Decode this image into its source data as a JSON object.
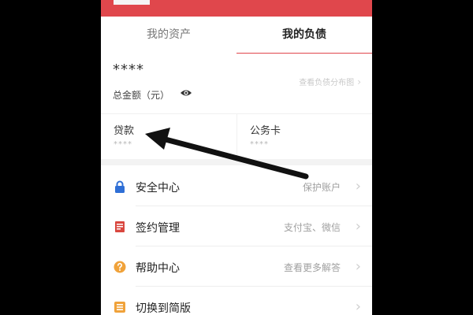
{
  "tabs": [
    {
      "label": "我的资产",
      "active": false
    },
    {
      "label": "我的负债",
      "active": true
    }
  ],
  "summary": {
    "masked_total": "****",
    "total_label": "总金额（元）",
    "eye_icon": "eye-icon",
    "distribution_link": "查看负债分布图"
  },
  "cards": [
    {
      "title": "贷款",
      "value": "****"
    },
    {
      "title": "公务卡",
      "value": "****"
    }
  ],
  "menu": [
    {
      "label": "安全中心",
      "hint": "保护账户",
      "icon": "lock-icon",
      "color": "#2f6fd6"
    },
    {
      "label": "签约管理",
      "hint": "支付宝、微信",
      "icon": "contract-icon",
      "color": "#d9473f"
    },
    {
      "label": "帮助中心",
      "hint": "查看更多解答",
      "icon": "help-icon",
      "color": "#f0a23a"
    },
    {
      "label": "切换到简版",
      "hint": "",
      "icon": "switch-icon",
      "color": "#f0a23a"
    }
  ],
  "colors": {
    "accent": "#e0474c",
    "background_outer": "#000000"
  }
}
